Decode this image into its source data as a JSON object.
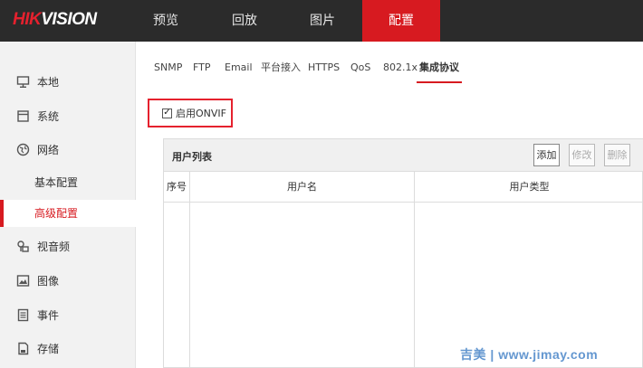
{
  "header": {
    "logo_part1": "HIK",
    "logo_part2": "VISION",
    "tabs": [
      {
        "label": "预览"
      },
      {
        "label": "回放"
      },
      {
        "label": "图片"
      },
      {
        "label": "配置",
        "active": true
      }
    ],
    "accent_color": "#d71a20"
  },
  "sidebar": {
    "items": [
      {
        "label": "本地",
        "icon": "monitor-icon"
      },
      {
        "label": "系统",
        "icon": "system-icon"
      },
      {
        "label": "网络",
        "icon": "globe-icon"
      },
      {
        "label": "视音频",
        "icon": "audio-video-icon"
      },
      {
        "label": "图像",
        "icon": "image-icon"
      },
      {
        "label": "事件",
        "icon": "event-icon"
      },
      {
        "label": "存储",
        "icon": "storage-icon"
      }
    ],
    "network_subitems": [
      {
        "label": "基本配置"
      },
      {
        "label": "高级配置",
        "active": true
      }
    ]
  },
  "subtabs": [
    {
      "label": "SNMP"
    },
    {
      "label": "FTP"
    },
    {
      "label": "Email"
    },
    {
      "label": "平台接入"
    },
    {
      "label": "HTTPS"
    },
    {
      "label": "QoS"
    },
    {
      "label": "802.1x"
    },
    {
      "label": "集成协议",
      "active": true
    }
  ],
  "onvif": {
    "label": "启用ONVIF",
    "checked": true,
    "check_mark": "✓"
  },
  "user_list": {
    "title": "用户列表",
    "buttons": {
      "add": "添加",
      "modify": "修改",
      "delete": "删除"
    },
    "columns": [
      "序号",
      "用户名",
      "用户类型"
    ],
    "rows": []
  },
  "watermark": "吉美 | www.jimay.com"
}
